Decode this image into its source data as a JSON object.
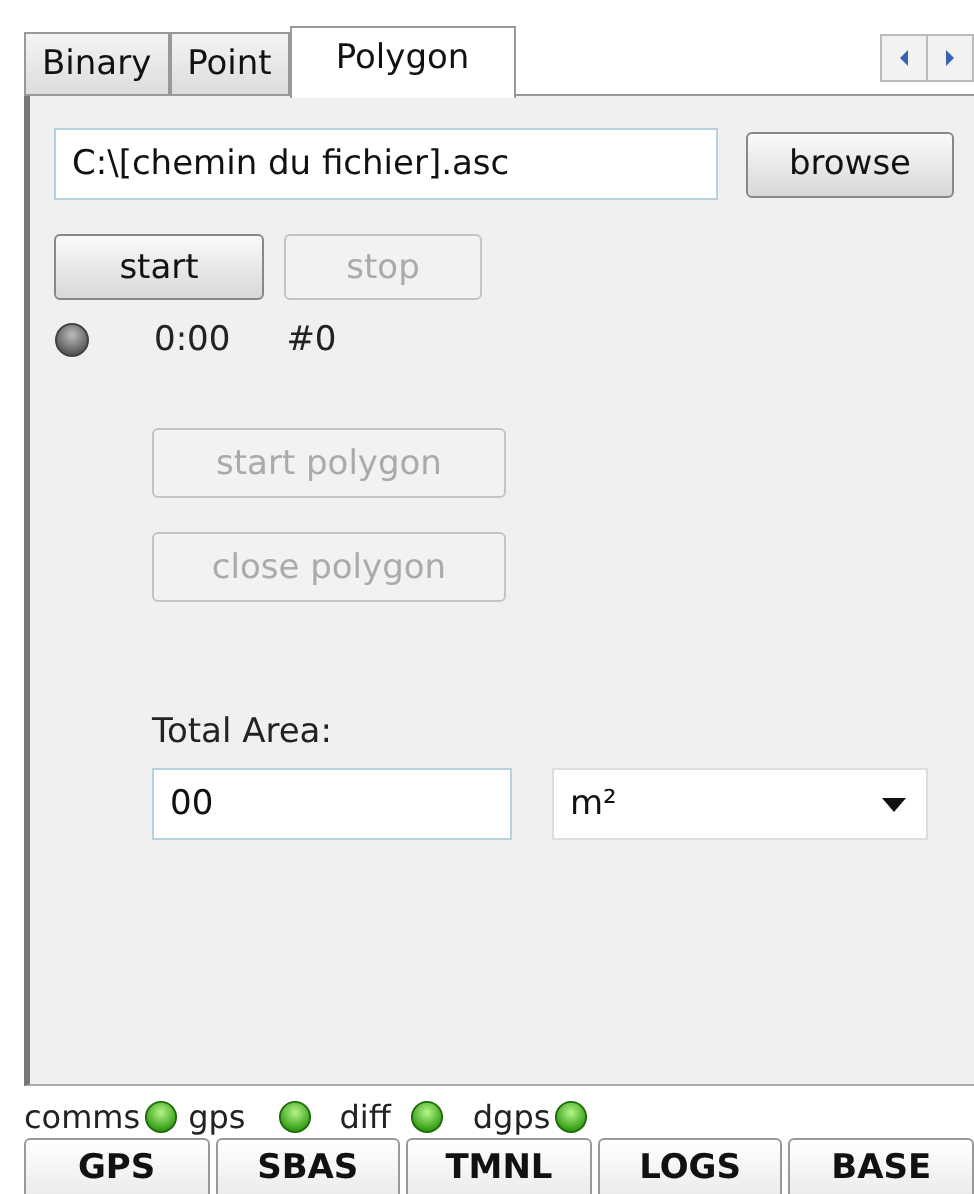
{
  "tabs": [
    {
      "label": "Binary",
      "selected": false
    },
    {
      "label": "Point",
      "selected": false
    },
    {
      "label": "Polygon",
      "selected": true
    }
  ],
  "file": {
    "value": "C:\\[chemin du fichier].asc",
    "browse": "browse"
  },
  "controls": [
    {
      "label": "start",
      "disabled": false
    },
    {
      "label": "stop",
      "disabled": true
    }
  ],
  "status": {
    "on": false,
    "time": "0:00",
    "count": "#0"
  },
  "polygon_buttons": [
    {
      "label": "start polygon",
      "disabled": true
    },
    {
      "label": "close polygon",
      "disabled": true
    }
  ],
  "area": {
    "label": "Total Area:",
    "value": "00",
    "unit": "m²"
  },
  "indicators": [
    {
      "label": "comms",
      "on": true
    },
    {
      "label": "gps",
      "on": true
    },
    {
      "label": "diff",
      "on": true
    },
    {
      "label": "dgps",
      "on": true
    }
  ],
  "bottom_tabs": [
    {
      "label": "GPS",
      "selected": false
    },
    {
      "label": "SBAS",
      "selected": false
    },
    {
      "label": "TMNL",
      "selected": false
    },
    {
      "label": "LOGS",
      "selected": false
    },
    {
      "label": "BASE",
      "selected": false
    }
  ]
}
